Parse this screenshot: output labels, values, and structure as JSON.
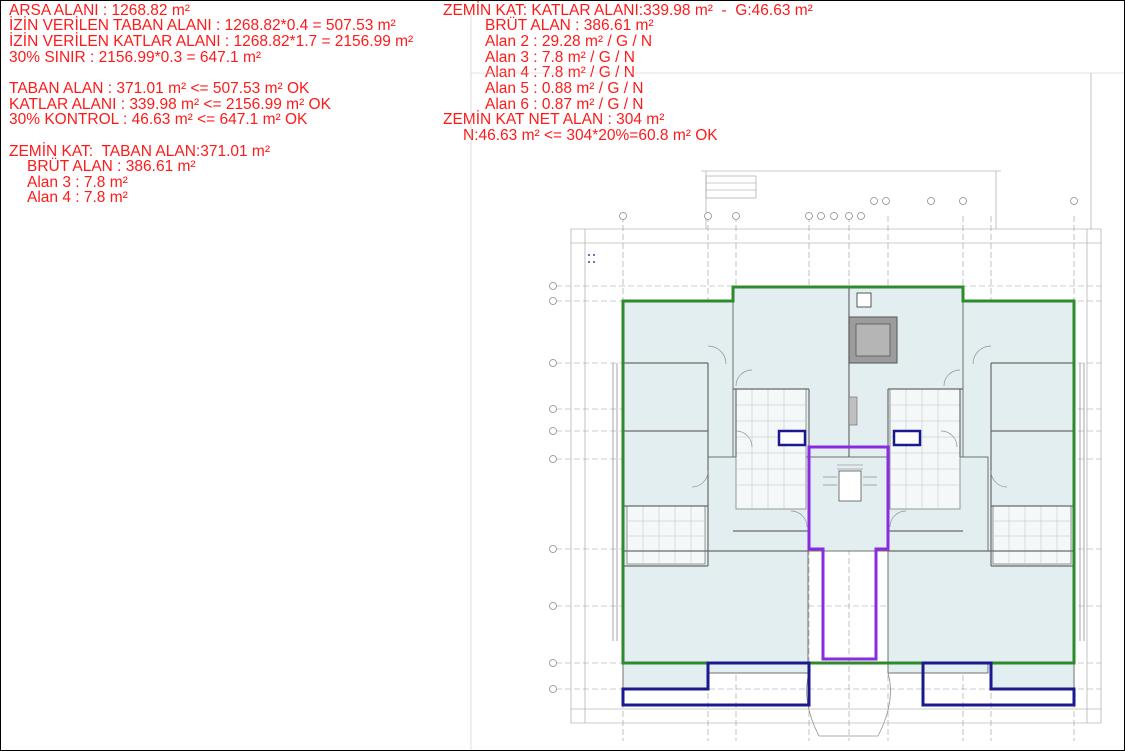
{
  "colors": {
    "text": "#ff1a1a",
    "outline_taban": "#2d8a2d",
    "outline_net": "#8a2be2",
    "outline_balcony": "#1a1a8c",
    "room_fill": "#e3eef0",
    "plan_lines": "#8a8a8a"
  },
  "left_block": {
    "arsa": "ARSA ALANI : 1268.82 m²",
    "izin_taban": "İZİN VERİLEN TABAN ALANI : 1268.82*0.4 = 507.53 m²",
    "izin_katlar": "İZİN VERİLEN KATLAR ALANI : 1268.82*1.7 = 2156.99 m²",
    "sinir": "30% SINIR : 2156.99*0.3 = 647.1 m²",
    "taban_alan": "TABAN ALAN : 371.01 m² <= 507.53 m² OK",
    "katlar_alani": "KATLAR ALANI : 339.98 m² <= 2156.99 m² OK",
    "kontrol": "30% KONTROL : 46.63 m² <= 647.1 m² OK",
    "zemin_kat": "ZEMİN KAT:  TABAN ALAN:371.01 m²",
    "brut": "BRÜT ALAN : 386.61 m²",
    "alan3": "Alan 3 : 7.8 m²",
    "alan4": "Alan 4 : 7.8 m²"
  },
  "right_block": {
    "zemin_kat": "ZEMİN KAT: KATLAR ALANI:339.98 m²  -  G:46.63 m²",
    "brut": "BRÜT ALAN : 386.61 m²",
    "alan2": "Alan 2 : 29.28 m² / G / N",
    "alan3": "Alan 3 : 7.8 m² / G / N",
    "alan4": "Alan 4 : 7.8 m² / G / N",
    "alan5": "Alan 5 : 0.88 m² / G / N",
    "alan6": "Alan 6 : 0.87 m² / G / N",
    "net_alan": "ZEMİN KAT NET ALAN : 304 m²",
    "net_check": "N:46.63 m² <= 304*20%=60.8 m² OK"
  }
}
